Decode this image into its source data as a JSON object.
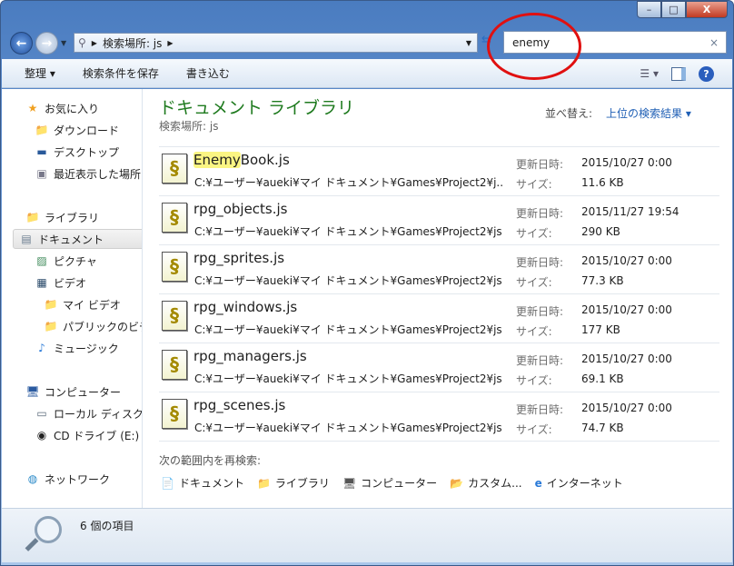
{
  "window": {
    "caption": {
      "minimize": "–",
      "maximize": "□",
      "close": "X"
    }
  },
  "address": {
    "crumbs": [
      "検索場所: js"
    ]
  },
  "search": {
    "value": "enemy",
    "clear": "×"
  },
  "toolbar": {
    "organize": "整理 ▾",
    "save_search": "検索条件を保存",
    "burn": "書き込む",
    "help": "?"
  },
  "sidebar": {
    "items": [
      {
        "label": "お気に入り",
        "icon": "star-icon",
        "level": 0
      },
      {
        "label": "ダウンロード",
        "icon": "download-folder-icon",
        "level": 1
      },
      {
        "label": "デスクトップ",
        "icon": "desktop-icon",
        "level": 1
      },
      {
        "label": "最近表示した場所",
        "icon": "recent-places-icon",
        "level": 1
      },
      {
        "label": "ライブラリ",
        "icon": "library-icon",
        "level": 0
      },
      {
        "label": "ドキュメント",
        "icon": "document-icon",
        "level": 1,
        "selected": true
      },
      {
        "label": "ピクチャ",
        "icon": "picture-icon",
        "level": 1
      },
      {
        "label": "ビデオ",
        "icon": "video-icon",
        "level": 1
      },
      {
        "label": "マイ ビデオ",
        "icon": "video-folder-icon",
        "level": 2
      },
      {
        "label": "パブリックのビデオ",
        "icon": "folder-icon",
        "level": 2
      },
      {
        "label": "ミュージック",
        "icon": "music-icon",
        "level": 1
      },
      {
        "label": "コンピューター",
        "icon": "computer-icon",
        "level": 0
      },
      {
        "label": "ローカル ディスク",
        "icon": "local-disk-icon",
        "level": 1
      },
      {
        "label": "CD ドライブ (E:)",
        "icon": "cd-drive-icon",
        "level": 1
      },
      {
        "label": "ネットワーク",
        "icon": "network-icon",
        "level": 0
      }
    ]
  },
  "content": {
    "title": "ドキュメント ライブラリ",
    "subtitle": "検索場所: js",
    "sort_label": "並べ替え:",
    "sort_value": "上位の検索結果 ▾",
    "modified_label": "更新日時:",
    "size_label": "サイズ:",
    "results": [
      {
        "match": "Enemy",
        "rest": "Book.js",
        "path": "C:¥ユーザー¥aueki¥マイ ドキュメント¥Games¥Project2¥j...",
        "modified": "2015/10/27 0:00",
        "size": "11.6 KB"
      },
      {
        "match": "",
        "rest": "rpg_objects.js",
        "path": "C:¥ユーザー¥aueki¥マイ ドキュメント¥Games¥Project2¥js",
        "modified": "2015/11/27 19:54",
        "size": "290 KB"
      },
      {
        "match": "",
        "rest": "rpg_sprites.js",
        "path": "C:¥ユーザー¥aueki¥マイ ドキュメント¥Games¥Project2¥js",
        "modified": "2015/10/27 0:00",
        "size": "77.3 KB"
      },
      {
        "match": "",
        "rest": "rpg_windows.js",
        "path": "C:¥ユーザー¥aueki¥マイ ドキュメント¥Games¥Project2¥js",
        "modified": "2015/10/27 0:00",
        "size": "177 KB"
      },
      {
        "match": "",
        "rest": "rpg_managers.js",
        "path": "C:¥ユーザー¥aueki¥マイ ドキュメント¥Games¥Project2¥js",
        "modified": "2015/10/27 0:00",
        "size": "69.1 KB"
      },
      {
        "match": "",
        "rest": "rpg_scenes.js",
        "path": "C:¥ユーザー¥aueki¥マイ ドキュメント¥Games¥Project2¥js",
        "modified": "2015/10/27 0:00",
        "size": "74.7 KB"
      }
    ],
    "research_label": "次の範囲内を再検索:",
    "research": [
      {
        "label": "ドキュメント",
        "icon": "📄"
      },
      {
        "label": "ライブラリ",
        "icon": "📁"
      },
      {
        "label": "コンピューター",
        "icon": "🖥"
      },
      {
        "label": "カスタム...",
        "icon": "📂"
      },
      {
        "label": "インターネット",
        "icon": "e"
      }
    ]
  },
  "status": {
    "count": "6 個の項目"
  },
  "colors": {
    "title_green": "#1e7a1e",
    "link_blue": "#1f5fb5",
    "highlight": "#fbf583",
    "annotation_red": "#e01010"
  }
}
